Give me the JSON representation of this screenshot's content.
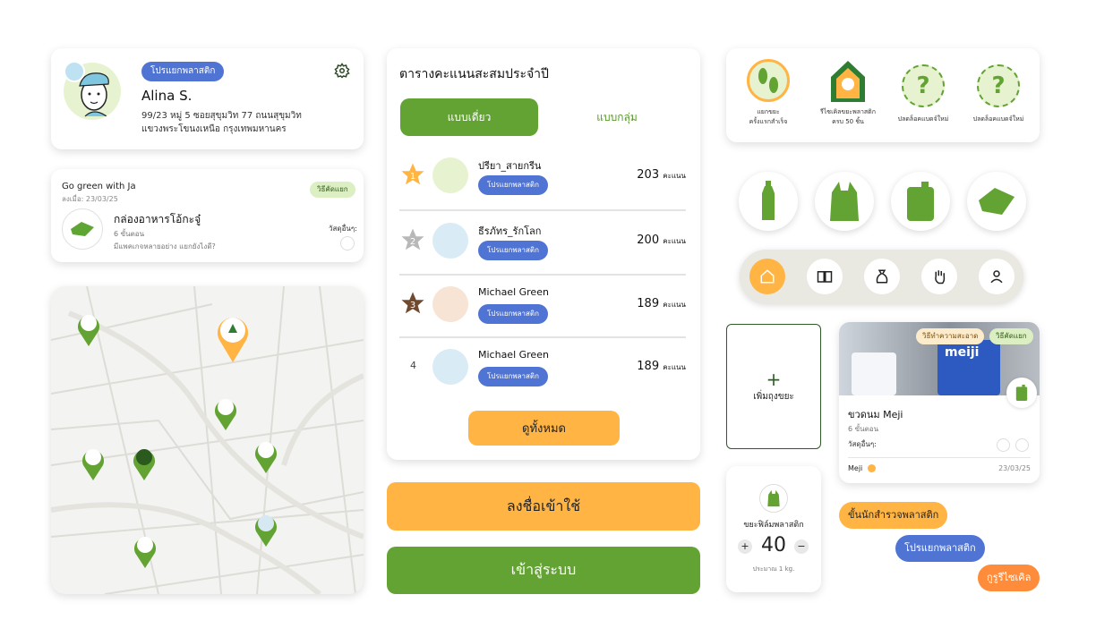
{
  "profile": {
    "badge": "โปรแยกพลาสติก",
    "name": "Alina S.",
    "address_line1": "99/23 หมู่ 5 ซอยสุขุมวิท 77 ถนนสุขุมวิท",
    "address_line2": "แขวงพระโขนงเหนือ กรุงเทพมหานคร",
    "icon": "gear-icon"
  },
  "post": {
    "author": "Go green with Ja",
    "date": "ลงเมื่อ: 23/03/25",
    "tag": "วิธีคัดแยก",
    "title": "กล่องอาหารโอ้กะจู๋",
    "steps": "6 ขั้นตอน",
    "question": "มีแพคเกจหลายอย่าง แยกยังไงดี?",
    "material_label": "วัสดุอื่นๆ:"
  },
  "map": {
    "pins": [
      "recycle-day",
      "yolo",
      "yolo",
      "yolo",
      "recycle",
      "vegetable",
      "recycle-leaf",
      "bag",
      "recycle-leaf"
    ]
  },
  "leaderboard": {
    "title": "ตารางคะแนนสะสมประจำปี",
    "tab_solo": "แบบเดี่ยว",
    "tab_group": "แบบกลุ่ม",
    "unit": "คะแนน",
    "rows": [
      {
        "rank": "1",
        "name": "ปรียา_สายกรีน",
        "badge": "โปรแยกพลาสติก",
        "score": "203"
      },
      {
        "rank": "2",
        "name": "ธีรภัทร_รักโลก",
        "badge": "โปรแยกพลาสติก",
        "score": "200"
      },
      {
        "rank": "3",
        "name": "Michael Green",
        "badge": "โปรแยกพลาสติก",
        "score": "189"
      },
      {
        "rank": "4",
        "name": "Michael Green",
        "badge": "โปรแยกพลาสติก",
        "score": "189"
      }
    ],
    "view_all": "ดูทั้งหมด"
  },
  "buttons": {
    "register": "ลงชื่อเข้าใช้",
    "login": "เข้าสู่ระบบ"
  },
  "achievements": [
    {
      "label1": "แยกขยะ",
      "label2": "ครั้งแรกสำเร็จ"
    },
    {
      "label1": "รีไซเคิลขยะพลาสติก",
      "label2": "ครบ 50 ชิ้น"
    },
    {
      "label1": "ปลดล็อคแบดจ์ใหม่",
      "label2": ""
    },
    {
      "label1": "ปลดล็อคแบดจ์ใหม่",
      "label2": ""
    }
  ],
  "waste_icons": [
    "bottle-icon",
    "plastic-bag-icon",
    "gallon-icon",
    "food-box-icon"
  ],
  "nav": [
    "home-icon",
    "book-icon",
    "sack-icon",
    "hand-icon",
    "user-icon"
  ],
  "add_waste": {
    "label": "เพิ่มถุงขยะ"
  },
  "counter": {
    "title": "ขยะฟิล์มพลาสติก",
    "value": "40",
    "note": "ประมาณ 1 kg.",
    "minus": "−",
    "plus": "+"
  },
  "product": {
    "tag1": "วิธีทำความสะอาด",
    "tag2": "วิธีคัดแยก",
    "title": "ขวดนม Meji",
    "steps": "6 ขั้นตอน",
    "material_label": "วัสดุอื่นๆ:",
    "brand": "Meji",
    "date": "23/03/25",
    "image_text": "meiji"
  },
  "level_tags": {
    "tag1": "ขั้นนักสำรวจพลาสติก",
    "tag2": "โปรแยกพลาสติก",
    "tag3": "กูรูรีไซเคิล"
  },
  "colors": {
    "green": "#63a333",
    "orange": "#ffb444",
    "blue": "#4f74d3",
    "light_green": "#dcefc3",
    "dark_orange": "#ff8c3a"
  }
}
